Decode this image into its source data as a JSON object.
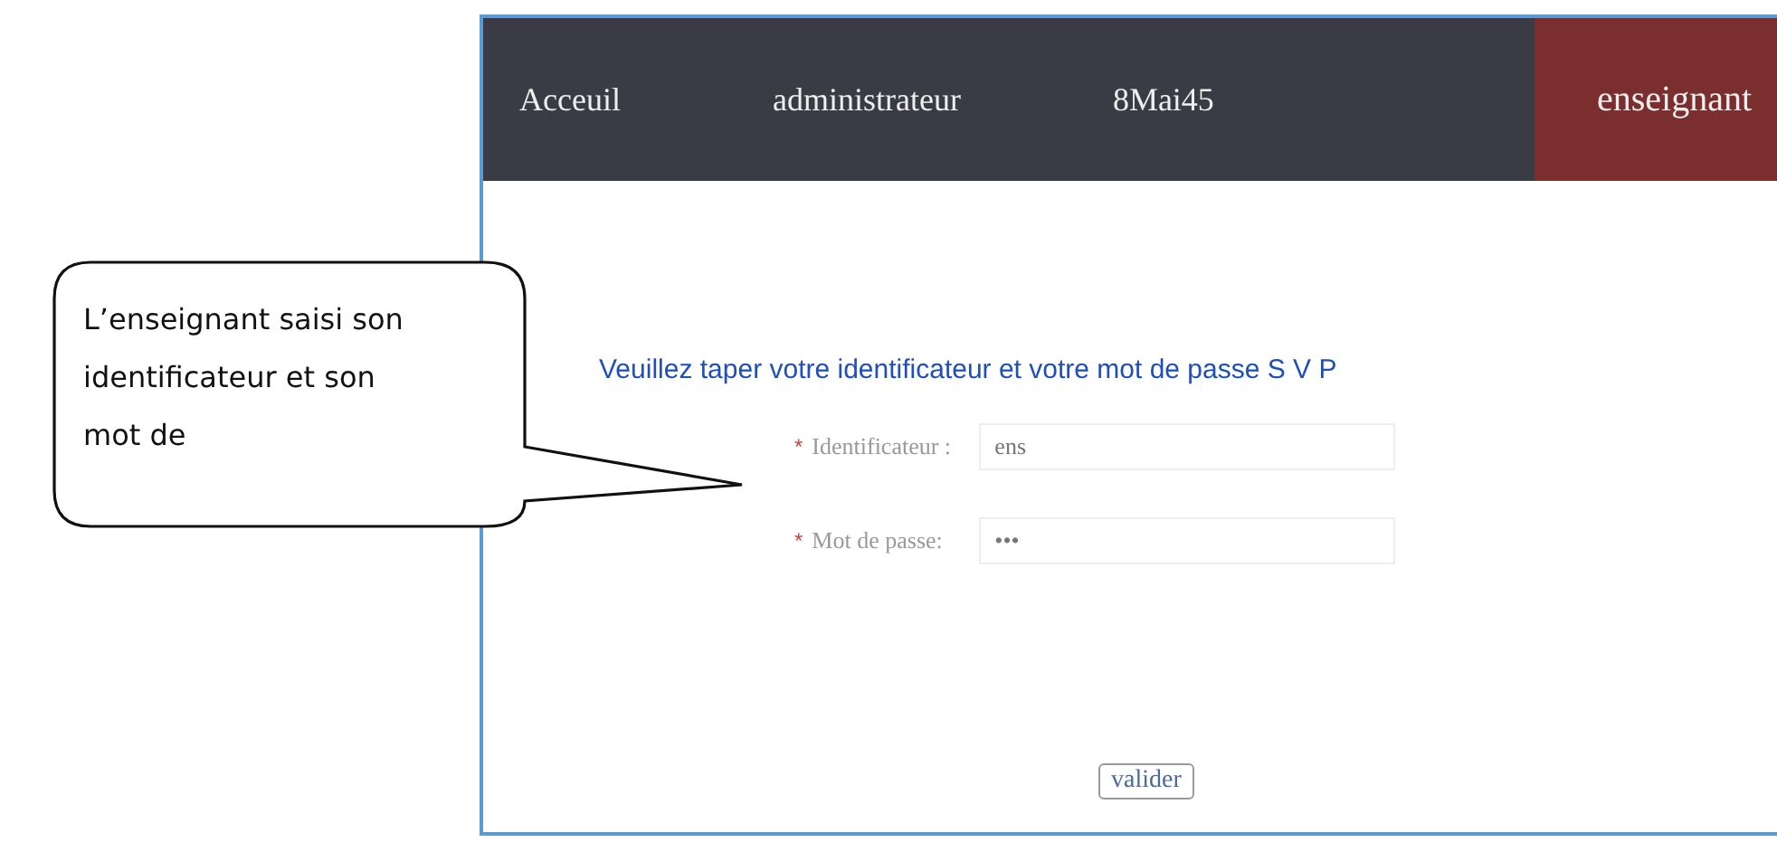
{
  "nav": {
    "tabs": [
      {
        "label": "Acceuil",
        "selected": false
      },
      {
        "label": "administrateur",
        "selected": false
      },
      {
        "label": "8Mai45",
        "selected": false
      },
      {
        "label": "enseignant",
        "selected": true
      }
    ]
  },
  "login": {
    "message": "Veuillez taper votre identificateur et votre mot de passe S V P",
    "fields": [
      {
        "marker": "*",
        "label": "Identificateur :",
        "value": "ens"
      },
      {
        "marker": "*",
        "label": "Mot de passe:",
        "value": "•••"
      }
    ],
    "submit": "valider"
  },
  "callout": {
    "text": "L’enseignant saisi son identificateur et son mot de"
  }
}
